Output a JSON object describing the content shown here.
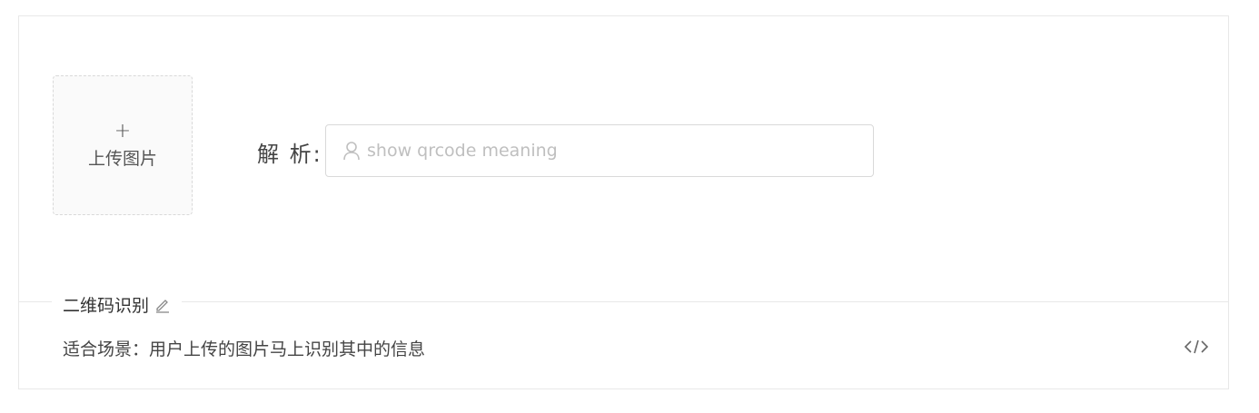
{
  "uploader": {
    "plus_icon": "plus-icon",
    "label": "上传图片"
  },
  "parse": {
    "label": "解 析:",
    "input_placeholder": "show qrcode meaning",
    "input_value": "",
    "prefix_icon": "user-icon"
  },
  "section": {
    "title": "二维码识别",
    "edit_icon": "edit-icon",
    "description": "适合场景：用户上传的图片马上识别其中的信息",
    "code_icon": "code-icon"
  }
}
